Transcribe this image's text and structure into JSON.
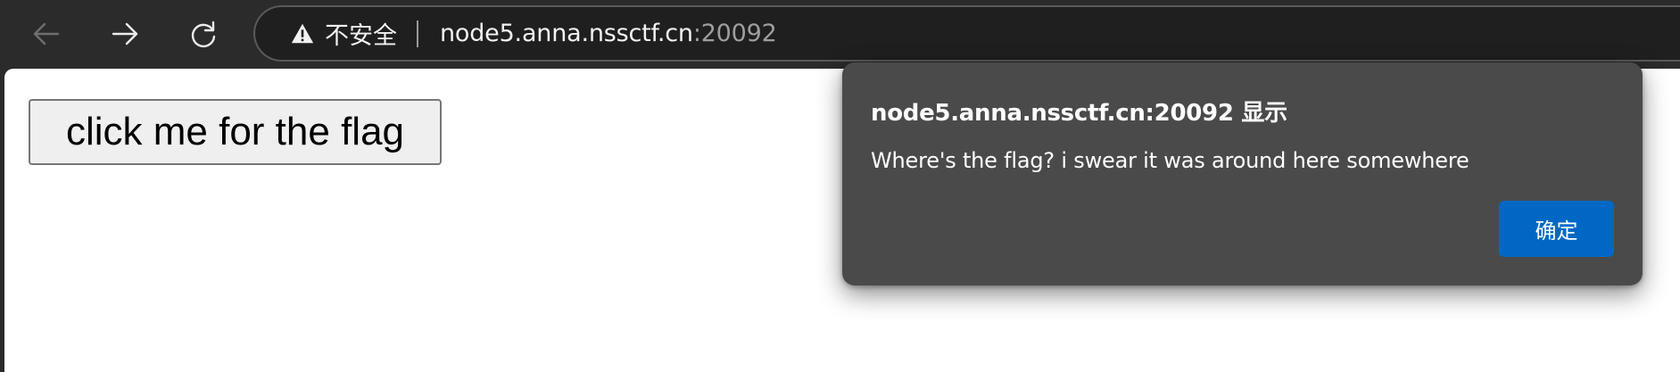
{
  "browser": {
    "security_label": "不安全",
    "url_host": "node5.anna.nssctf.cn",
    "url_port": ":20092",
    "icons": {
      "back": "arrow-left-icon",
      "forward": "arrow-right-icon",
      "reload": "reload-icon",
      "security": "warning-triangle-icon"
    }
  },
  "page": {
    "button_label": "click me for the flag"
  },
  "dialog": {
    "title": "node5.anna.nssctf.cn:20092 显示",
    "message": "Where's the flag? i swear it was around here somewhere",
    "ok_label": "确定",
    "colors": {
      "background": "#4a4a4a",
      "ok_button": "#0068c4"
    }
  }
}
